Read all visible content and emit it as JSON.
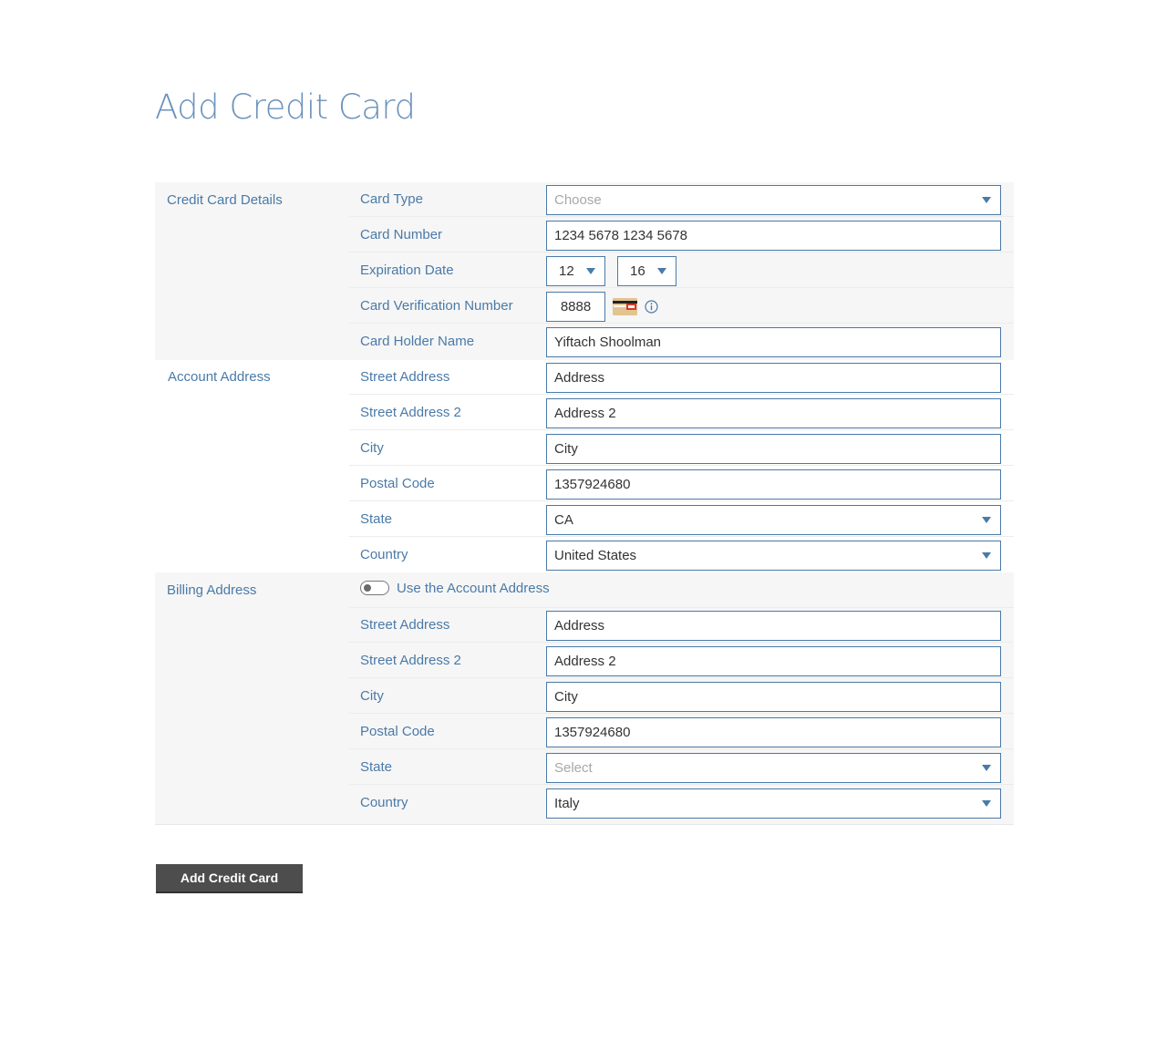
{
  "page": {
    "title": "Add Credit Card"
  },
  "credit_card_details": {
    "section_label": "Credit Card Details",
    "card_type": {
      "label": "Card Type",
      "placeholder": "Choose"
    },
    "card_number": {
      "label": "Card Number",
      "value": "1234 5678 1234 5678"
    },
    "expiration_date": {
      "label": "Expiration Date",
      "month": "12",
      "year": "16"
    },
    "cvv": {
      "label": "Card Verification Number",
      "value": "8888"
    },
    "card_holder_name": {
      "label": "Card Holder Name",
      "value": "Yiftach Shoolman"
    }
  },
  "account_address": {
    "section_label": "Account Address",
    "street": {
      "label": "Street Address",
      "value": "Address"
    },
    "street2": {
      "label": "Street Address 2",
      "value": "Address 2"
    },
    "city": {
      "label": "City",
      "value": "City"
    },
    "postal_code": {
      "label": "Postal Code",
      "value": "1357924680"
    },
    "state": {
      "label": "State",
      "value": "CA"
    },
    "country": {
      "label": "Country",
      "value": "United States"
    }
  },
  "billing_address": {
    "section_label": "Billing Address",
    "use_account_address": {
      "label": "Use the Account Address",
      "checked": false
    },
    "street": {
      "label": "Street Address",
      "value": "Address"
    },
    "street2": {
      "label": "Street Address 2",
      "value": "Address 2"
    },
    "city": {
      "label": "City",
      "value": "City"
    },
    "postal_code": {
      "label": "Postal Code",
      "value": "1357924680"
    },
    "state": {
      "label": "State",
      "placeholder": "Select"
    },
    "country": {
      "label": "Country",
      "value": "Italy"
    }
  },
  "actions": {
    "submit_label": "Add Credit Card"
  },
  "colors": {
    "accent": "#4a7aa8",
    "title": "#6b93bc",
    "button": "#4d4d4d",
    "section_bg": "#f6f6f6"
  }
}
